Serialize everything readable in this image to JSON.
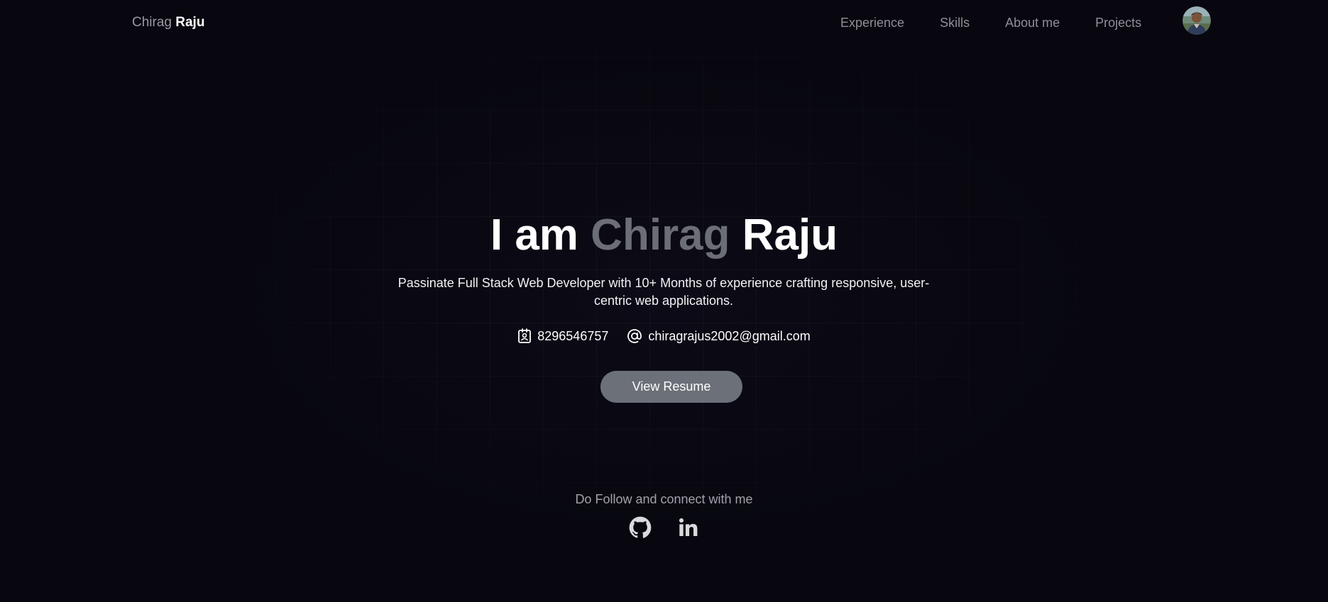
{
  "header": {
    "logo_first": "Chirag",
    "logo_last": "Raju",
    "nav": [
      {
        "label": "Experience"
      },
      {
        "label": "Skills"
      },
      {
        "label": "About me"
      },
      {
        "label": "Projects"
      }
    ],
    "avatar_icon": "profile-photo"
  },
  "hero": {
    "title_prefix": "I am",
    "title_first": "Chirag",
    "title_last": "Raju",
    "subtitle": "Passinate Full Stack Web Developer with 10+ Months of experience crafting responsive, user-centric web applications.",
    "phone": "8296546757",
    "phone_icon": "contact-card-icon",
    "email": "chiragrajus2002@gmail.com",
    "email_icon": "at-sign-icon",
    "resume_button": "View Resume"
  },
  "social": {
    "heading": "Do Follow and connect with me",
    "links": [
      {
        "icon": "github-icon"
      },
      {
        "icon": "linkedin-icon"
      }
    ]
  },
  "colors": {
    "background": "#08070f",
    "accent_grey": "#6b6e77",
    "button": "#6b7079",
    "nav_text": "#8f8f99"
  }
}
